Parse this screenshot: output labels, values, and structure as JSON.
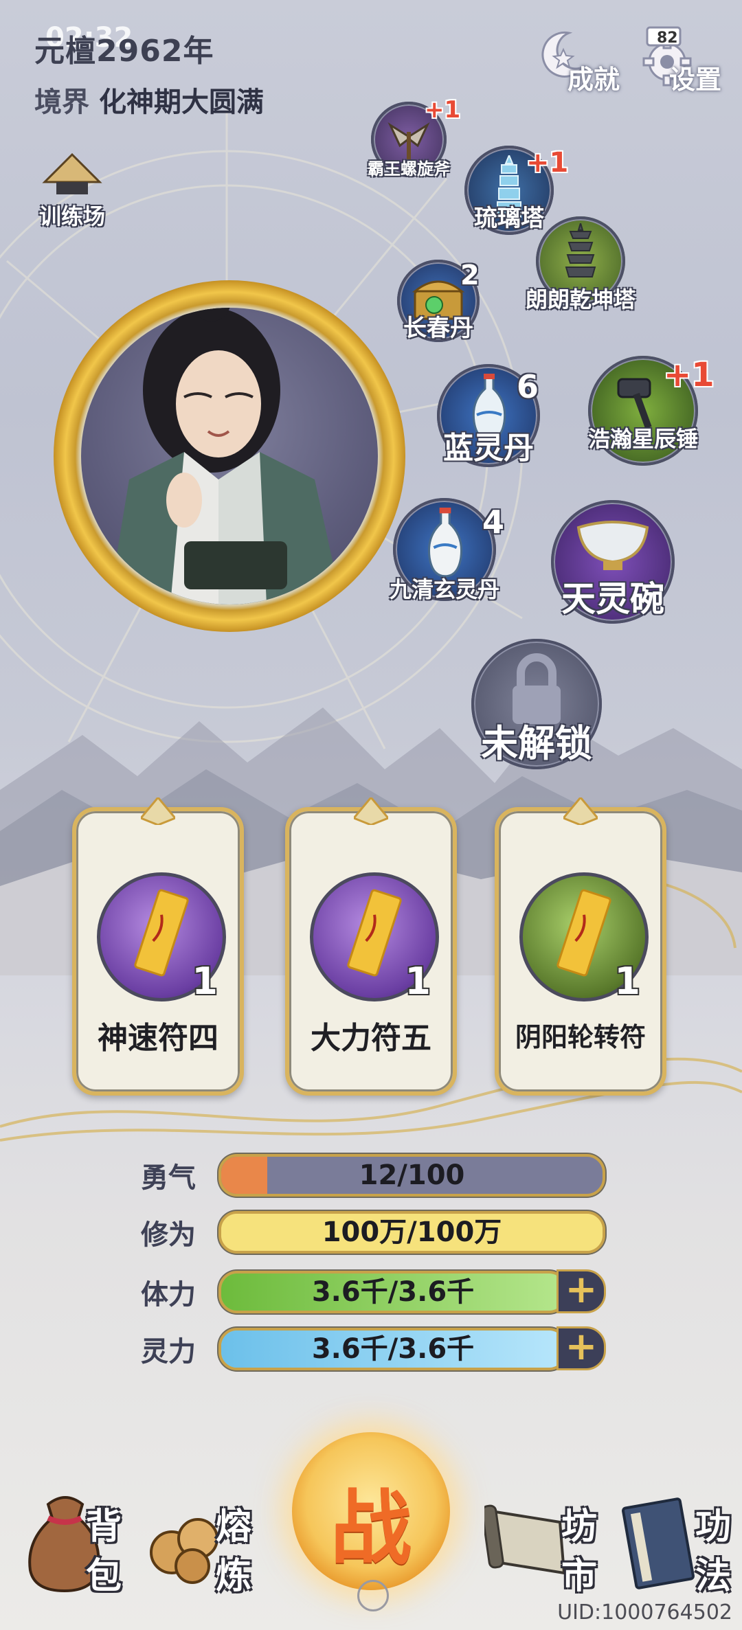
{
  "status_bar": {
    "time": "02:32",
    "battery": "82"
  },
  "header": {
    "era": "元檀2962年",
    "realm_label": "境界",
    "realm_value": "化神期大圆满"
  },
  "top_buttons": {
    "achievements_label": "成就",
    "settings_label": "设置"
  },
  "training_ground_label": "训练场",
  "equipment_items": [
    {
      "name": "霸王螺旋斧",
      "badge": "+1"
    },
    {
      "name": "琉璃塔",
      "badge": "+1"
    },
    {
      "name": "朗朗乾坤塔",
      "badge": ""
    },
    {
      "name": "长春丹",
      "count": "2"
    },
    {
      "name": "蓝灵丹",
      "count": "6"
    },
    {
      "name": "浩瀚星辰锤",
      "badge": "+1"
    },
    {
      "name": "九清玄灵丹",
      "count": "4"
    },
    {
      "name": "天灵碗",
      "count": ""
    },
    {
      "name": "未解锁",
      "count": ""
    }
  ],
  "talismans": [
    {
      "name": "神速符四",
      "count": "1",
      "orb_color": "#6b3fa3"
    },
    {
      "name": "大力符五",
      "count": "1",
      "orb_color": "#6b3fa3"
    },
    {
      "name": "阴阳轮转符",
      "count": "1",
      "orb_color": "#5a7a2c"
    }
  ],
  "stats": [
    {
      "label": "勇气",
      "value": "12/100",
      "fraction": 0.12,
      "color": "#e9874a",
      "track": "#7a7c99"
    },
    {
      "label": "修为",
      "value": "100万/100万",
      "fraction": 1.0,
      "color": "#f6e27c",
      "track": "#f6e27c"
    },
    {
      "label": "体力",
      "value": "3.6千/3.6千",
      "fraction": 1.0,
      "color": "#8fd35a",
      "track": "#8fd35a"
    },
    {
      "label": "灵力",
      "value": "3.6千/3.6千",
      "fraction": 1.0,
      "color": "#8ad2f2",
      "track": "#8ad2f2"
    }
  ],
  "bottom_nav": {
    "bag": [
      "背",
      "包"
    ],
    "smelt": [
      "熔",
      "炼"
    ],
    "fight": "战",
    "market": [
      "坊",
      "市"
    ],
    "skills": [
      "功",
      "法"
    ]
  },
  "uid": "UID:1000764502"
}
